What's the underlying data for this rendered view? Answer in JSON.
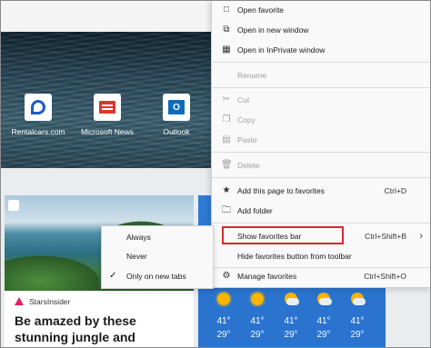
{
  "quick_links": [
    {
      "label": "Rentalcars.com",
      "icon": "rentalcars-logo"
    },
    {
      "label": "Microsoft News",
      "icon": "microsoft-news-logo"
    },
    {
      "label": "Outlook",
      "icon": "outlook-logo",
      "glyph": "O"
    }
  ],
  "article": {
    "source": "StarsInsider",
    "headline": "Be amazed by these stunning jungle and rainforest"
  },
  "weather": {
    "days": [
      {
        "icon": "sun",
        "high": "41°",
        "low": "29°"
      },
      {
        "icon": "sun",
        "high": "41°",
        "low": "29°"
      },
      {
        "icon": "partly-cloudy",
        "high": "41°",
        "low": "29°"
      },
      {
        "icon": "partly-cloudy",
        "high": "41°",
        "low": "29°"
      },
      {
        "icon": "partly-cloudy",
        "high": "41°",
        "low": "29°"
      }
    ]
  },
  "context_menu": {
    "open_favorite": "Open favorite",
    "open_new_window": "Open in new window",
    "open_inprivate": "Open in InPrivate window",
    "rename": "Rename",
    "cut": "Cut",
    "copy": "Copy",
    "paste": "Paste",
    "delete": "Delete",
    "add_to_favorites": "Add this page to favorites",
    "add_to_favorites_shortcut": "Ctrl+D",
    "add_folder": "Add folder",
    "show_favorites_bar": "Show favorites bar",
    "show_favorites_bar_shortcut": "Ctrl+Shift+B",
    "hide_favorites_button": "Hide favorites button from toolbar",
    "manage_favorites": "Manage favorites",
    "manage_favorites_shortcut": "Ctrl+Shift+O"
  },
  "favorites_bar_submenu": {
    "always": "Always",
    "never": "Never",
    "only_new_tabs": "Only on new tabs",
    "selected": "Only on new tabs",
    "check_glyph": "✓"
  },
  "colors": {
    "highlight_border": "#d7282f",
    "weather_blue": "#2e7bd6",
    "source_red": "#e0245e"
  }
}
